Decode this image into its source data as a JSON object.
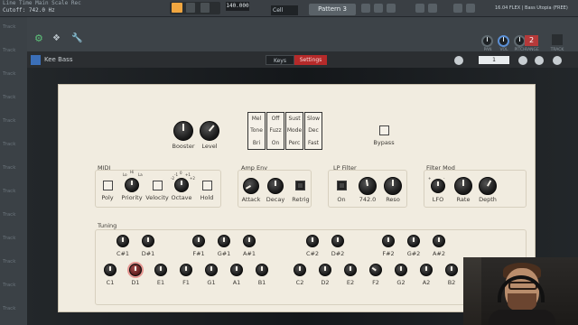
{
  "toolbar": {
    "status_line": "Line  Time  Main  Scale  Rec",
    "cutoff": "Cutoff: 742.0 Hz",
    "tempo": "140.000",
    "snap": "Cell",
    "pattern": "Pattern 3",
    "hint": "16.04 FLEX | Bass Utopia (FREE)"
  },
  "tracks": [
    "Track",
    "Track",
    "Track",
    "Track",
    "Track",
    "Track",
    "Track",
    "Track",
    "Track",
    "Track",
    "Track",
    "Track",
    "Track"
  ],
  "window": {
    "small_knobs": [
      "PAN",
      "VOL",
      "PITCH",
      "RANGE"
    ],
    "pitch_value": "2",
    "track_label": "TRACK",
    "track_value": "2"
  },
  "plugin": {
    "name": "Kee Bass",
    "tabs": {
      "keys": "Keys",
      "settings": "Settings"
    },
    "preset_number": "1"
  },
  "panel": {
    "top_knobs": [
      {
        "label": "Booster"
      },
      {
        "label": "Level"
      }
    ],
    "switches": [
      {
        "options": [
          "Mel",
          "Tone",
          "Bri"
        ]
      },
      {
        "options": [
          "Off",
          "Fuzz",
          "On"
        ]
      },
      {
        "options": [
          "Sust",
          "Mode",
          "Perc"
        ]
      },
      {
        "options": [
          "Slow",
          "Dec",
          "Fast"
        ]
      }
    ],
    "bypass": "Bypass",
    "midi": {
      "title": "MIDI",
      "controls": [
        "Poly",
        "Priority",
        "Velocity",
        "Octave",
        "Hold"
      ],
      "priority_ticks": {
        "low": "Lo",
        "mid": "Hi",
        "high": "La"
      },
      "octave_ticks": {
        "low": "-2",
        "mid": "-1",
        "mid2": "0",
        "high": "+1",
        "top": "+2"
      }
    },
    "amp_env": {
      "title": "Amp Env",
      "controls": [
        "Attack",
        "Decay",
        "Retrig"
      ]
    },
    "lp_filter": {
      "title": "LP Filter",
      "on_label": "On",
      "cutoff_value": "742.0",
      "reso_label": "Reso"
    },
    "filter_mod": {
      "title": "Filter Mod",
      "controls": [
        "LFO",
        "Rate",
        "Depth"
      ],
      "lfo_ticks": {
        "low": "+",
        "high": "-"
      }
    },
    "tuning": {
      "title": "Tuning",
      "sharps": [
        "C#1",
        "D#1",
        "F#1",
        "G#1",
        "A#1",
        "C#2",
        "D#2",
        "F#2",
        "G#2",
        "A#2"
      ],
      "naturals": [
        "C1",
        "D1",
        "E1",
        "F1",
        "G1",
        "A1",
        "B1",
        "C2",
        "D2",
        "E2",
        "F2",
        "G2",
        "A2",
        "B2"
      ]
    }
  }
}
